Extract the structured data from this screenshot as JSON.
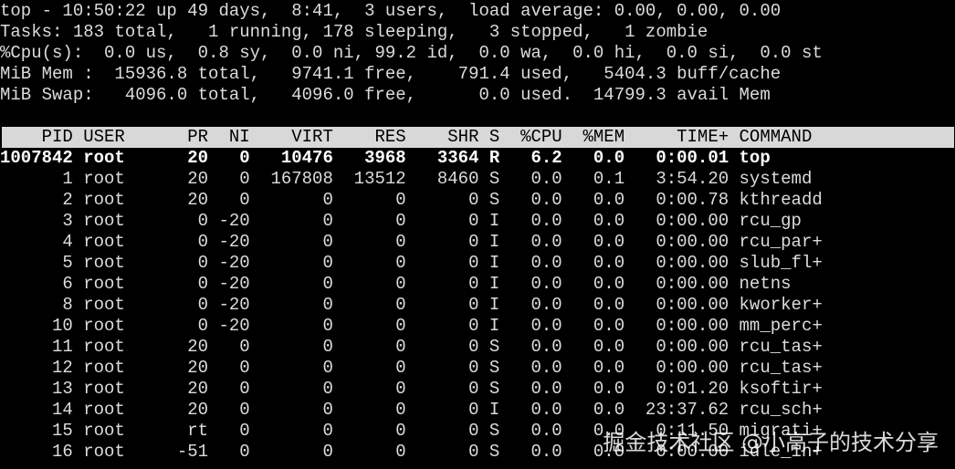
{
  "summary": {
    "uptime_line": "top - 10:50:22 up 49 days,  8:41,  3 users,  load average: 0.00, 0.00, 0.00",
    "tasks_line": "Tasks: 183 total,   1 running, 178 sleeping,   3 stopped,   1 zombie",
    "cpu_line": "%Cpu(s):  0.0 us,  0.8 sy,  0.0 ni, 99.2 id,  0.0 wa,  0.0 hi,  0.0 si,  0.0 st",
    "mem_line": "MiB Mem :  15936.8 total,   9741.1 free,    791.4 used,   5404.3 buff/cache",
    "swap_line": "MiB Swap:   4096.0 total,   4096.0 free,      0.0 used.  14799.3 avail Mem"
  },
  "table": {
    "header": "    PID USER      PR  NI    VIRT    RES    SHR S  %CPU  %MEM     TIME+ COMMAND",
    "rows": [
      "1007842 root      20   0   10476   3968   3364 R   6.2   0.0   0:00.01 top",
      "      1 root      20   0  167808  13512   8460 S   0.0   0.1   3:54.20 systemd",
      "      2 root      20   0       0      0      0 S   0.0   0.0   0:00.78 kthreadd",
      "      3 root       0 -20       0      0      0 I   0.0   0.0   0:00.00 rcu_gp",
      "      4 root       0 -20       0      0      0 I   0.0   0.0   0:00.00 rcu_par+",
      "      5 root       0 -20       0      0      0 I   0.0   0.0   0:00.00 slub_fl+",
      "      6 root       0 -20       0      0      0 I   0.0   0.0   0:00.00 netns",
      "      8 root       0 -20       0      0      0 I   0.0   0.0   0:00.00 kworker+",
      "     10 root       0 -20       0      0      0 I   0.0   0.0   0:00.00 mm_perc+",
      "     11 root      20   0       0      0      0 S   0.0   0.0   0:00.00 rcu_tas+",
      "     12 root      20   0       0      0      0 S   0.0   0.0   0:00.00 rcu_tas+",
      "     13 root      20   0       0      0      0 S   0.0   0.0   0:01.20 ksoftir+",
      "     14 root      20   0       0      0      0 I   0.0   0.0  23:37.62 rcu_sch+",
      "     15 root      rt   0       0      0      0 S   0.0   0.0   0:11.50 migrati+",
      "     16 root     -51   0       0      0      0 S   0.0   0.0   0:00.00 idle_in+"
    ]
  },
  "watermark": "掘金技术社区 @小高子的技术分享"
}
